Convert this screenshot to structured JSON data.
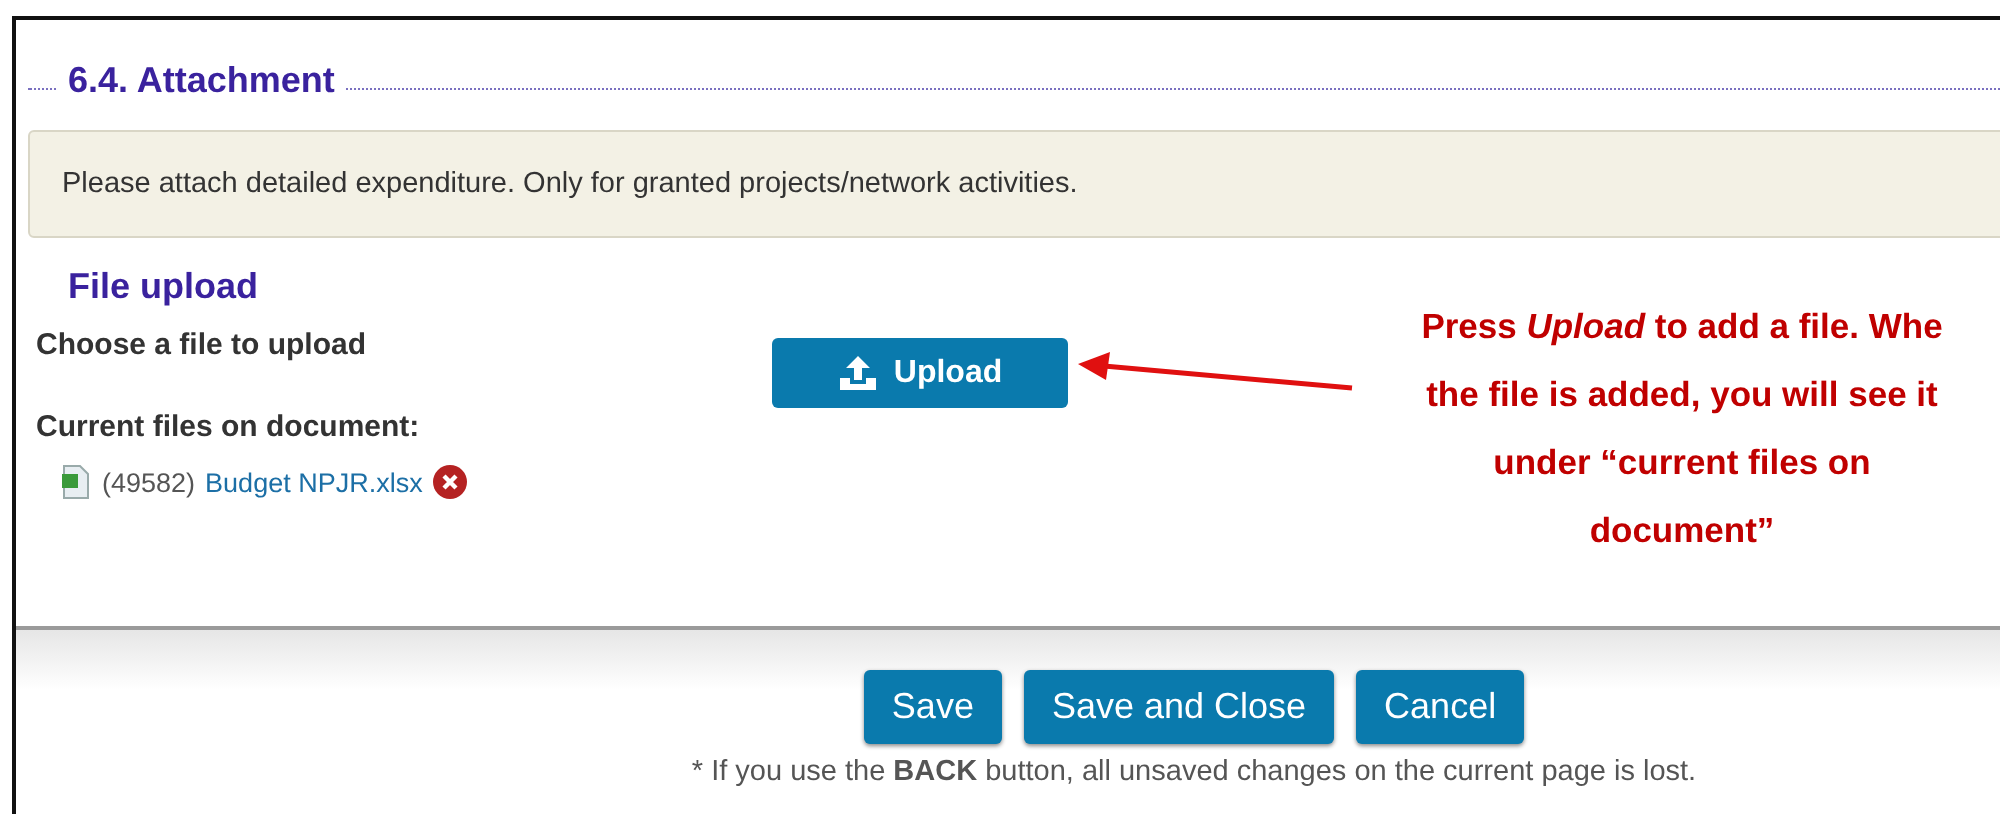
{
  "section_title": "6.4. Attachment",
  "info_text": "Please attach detailed expenditure. Only for granted projects/network activities.",
  "file_upload": {
    "heading": "File upload",
    "choose_label": "Choose a file to upload",
    "upload_button": "Upload",
    "current_files_label": "Current files on document:",
    "files": [
      {
        "number": "(49582)",
        "name": "Budget NPJR.xlsx"
      }
    ]
  },
  "annotation": "Press *Upload* to add a file. Whe\nthe file is added, you will see it\nunder “current files on\ndocument”",
  "buttons": [
    "Save",
    "Save and Close",
    "Cancel"
  ],
  "footnote": "* If you use the **BACK** button, all unsaved changes on the current page is lost."
}
